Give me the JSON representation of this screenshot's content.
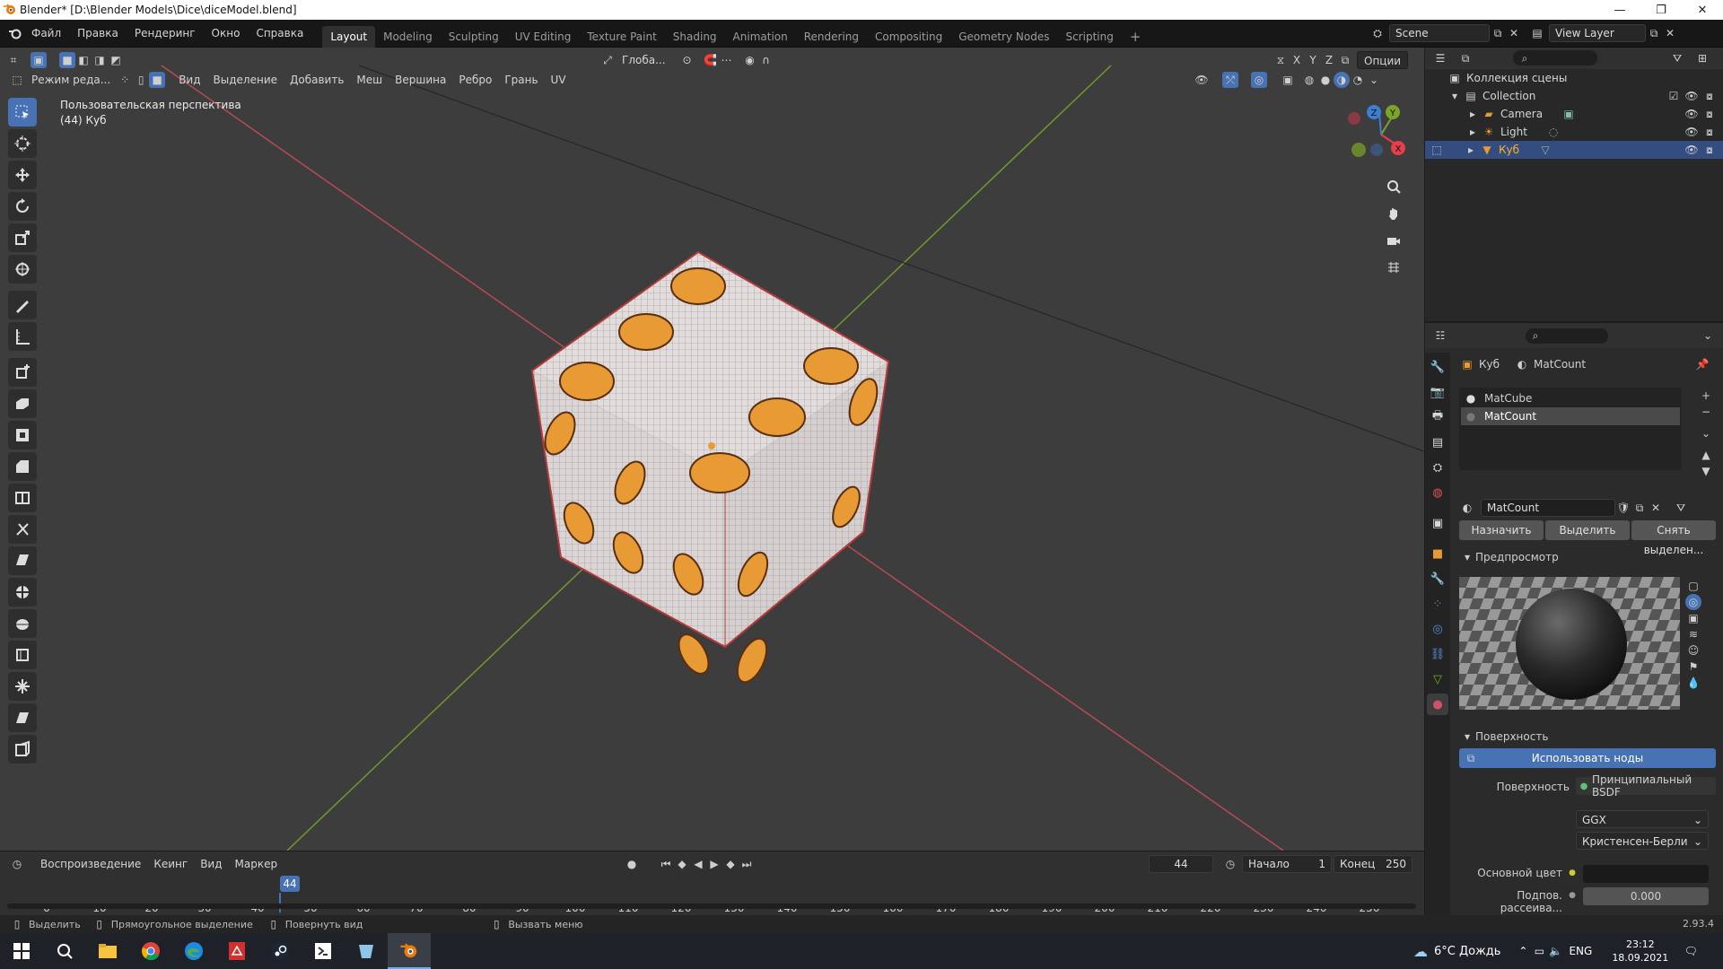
{
  "window": {
    "title": "Blender* [D:\\Blender Models\\Dice\\diceModel.blend]",
    "buttons": [
      "—",
      "❐",
      "✕"
    ]
  },
  "menu": [
    "Файл",
    "Правка",
    "Рендеринг",
    "Окно",
    "Справка"
  ],
  "workspaces": [
    "Layout",
    "Modeling",
    "Sculpting",
    "UV Editing",
    "Texture Paint",
    "Shading",
    "Animation",
    "Rendering",
    "Compositing",
    "Geometry Nodes",
    "Scripting"
  ],
  "active_workspace": "Layout",
  "scene": {
    "label": "Scene",
    "view_layer": "View Layer"
  },
  "header2": {
    "transform": "Глоба...",
    "options": "Опции",
    "axes": [
      "X",
      "Y",
      "Z"
    ]
  },
  "viewport_header": {
    "mode": "Режим реда...",
    "menus": [
      "Вид",
      "Выделение",
      "Добавить",
      "Меш",
      "Вершина",
      "Ребро",
      "Грань",
      "UV"
    ]
  },
  "viewport": {
    "perspective": "Пользовательская перспектива",
    "object_info": "(44) Куб"
  },
  "gizmo": {
    "x": "X",
    "y": "Y",
    "z": "Z"
  },
  "colors": {
    "accent": "#4772b3",
    "x_axis": "#e53f4c",
    "y_axis": "#7aa526",
    "z_axis": "#3d7dd3",
    "die_pip": "#e89a35",
    "selection": "#334d80"
  },
  "outliner": {
    "root": "Коллекция сцены",
    "collection": "Collection",
    "items": [
      {
        "name": "Camera",
        "icon": "camera-icon"
      },
      {
        "name": "Light",
        "icon": "light-icon"
      },
      {
        "name": "Куб",
        "icon": "mesh-icon",
        "selected": true
      }
    ]
  },
  "properties": {
    "object": "Куб",
    "material": "MatCount",
    "slots": [
      "MatCube",
      "MatCount"
    ],
    "selected_slot": "MatCount",
    "datablock": "MatCount",
    "buttons": [
      "Назначить",
      "Выделить",
      "Снять выделен..."
    ],
    "preview_header": "Предпросмотр",
    "surface_header": "Поверхность",
    "use_nodes": "Использовать ноды",
    "surface_label": "Поверхность",
    "surface_value": "Принципиальный BSDF",
    "distribution": "GGX",
    "subsurface_method": "Кристенсен-Берли",
    "base_color_label": "Основной цвет",
    "subsurface_label": "Подпов. рассеива...",
    "subsurface_value": "0.000"
  },
  "timeline": {
    "menus": [
      "Воспроизведение",
      "Кеинг",
      "Вид",
      "Маркер"
    ],
    "current_frame": "44",
    "start_label": "Начало",
    "start": "1",
    "end_label": "Конец",
    "end": "250",
    "ticks": [
      "0",
      "10",
      "20",
      "30",
      "40",
      "50",
      "60",
      "70",
      "80",
      "90",
      "100",
      "110",
      "120",
      "130",
      "140",
      "150",
      "160",
      "170",
      "180",
      "190",
      "200",
      "210",
      "220",
      "230",
      "240",
      "250"
    ]
  },
  "statusbar": {
    "select": "Выделить",
    "box_select": "Прямоугольное выделение",
    "rotate": "Повернуть вид",
    "call_menu": "Вызвать меню",
    "version": "2.93.4"
  },
  "taskbar": {
    "weather": "6°C  Дождь",
    "lang": "ENG",
    "time": "23:12",
    "date": "18.09.2021"
  }
}
